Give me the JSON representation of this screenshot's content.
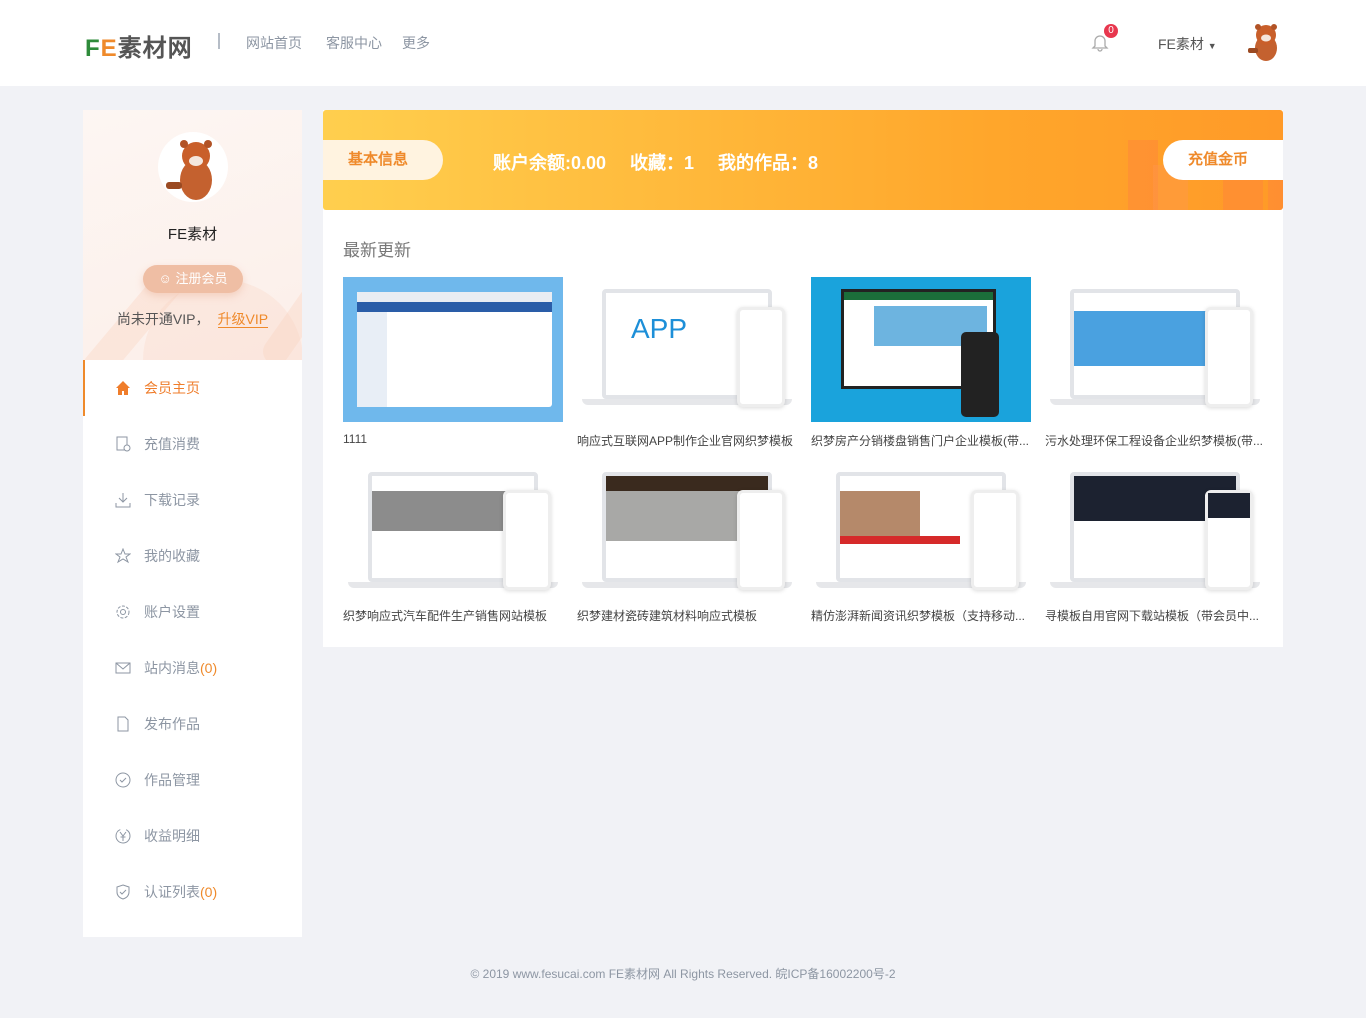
{
  "header": {
    "logo_f": "F",
    "logo_e": "E",
    "logo_rest": "素材网",
    "nav": [
      "网站首页",
      "客服中心",
      "更多"
    ],
    "notification_count": "0",
    "username": "FE素材"
  },
  "profile": {
    "name": "FE素材",
    "register_label": "注册会员",
    "vip_text": "尚未开通VIP，",
    "upgrade_label": "升级VIP"
  },
  "menu": [
    {
      "label": "会员主页",
      "icon": "home-icon"
    },
    {
      "label": "充值消费",
      "icon": "recharge-icon"
    },
    {
      "label": "下载记录",
      "icon": "download-icon"
    },
    {
      "label": "我的收藏",
      "icon": "star-icon"
    },
    {
      "label": "账户设置",
      "icon": "gear-icon"
    },
    {
      "label": "站内消息",
      "count": "(0)",
      "icon": "mail-icon"
    },
    {
      "label": "发布作品",
      "icon": "file-icon"
    },
    {
      "label": "作品管理",
      "icon": "check-circle-icon"
    },
    {
      "label": "收益明细",
      "icon": "yen-icon"
    },
    {
      "label": "认证列表",
      "count": "(0)",
      "icon": "shield-icon"
    }
  ],
  "banner": {
    "tab": "基本信息",
    "balance": "账户余额:0.00",
    "favorites": "收藏：1",
    "works": "我的作品：8",
    "charge": "充值金币"
  },
  "section_title": "最新更新",
  "cards": [
    {
      "title": "1111"
    },
    {
      "title": "响应式互联网APP制作企业官网织梦模板"
    },
    {
      "title": "织梦房产分销楼盘销售门户企业模板(带..."
    },
    {
      "title": "污水处理环保工程设备企业织梦模板(带..."
    },
    {
      "title": "织梦响应式汽车配件生产销售网站模板"
    },
    {
      "title": "织梦建材瓷砖建筑材料响应式模板"
    },
    {
      "title": "精仿澎湃新闻资讯织梦模板（支持移动..."
    },
    {
      "title": "寻模板自用官网下载站模板（带会员中..."
    }
  ],
  "footer": "© 2019 www.fesucai.com FE素材网 All Rights Reserved. 皖ICP备16002200号-2",
  "colors": {
    "accent": "#ef8a2b",
    "bg": "#f1f2f6"
  }
}
